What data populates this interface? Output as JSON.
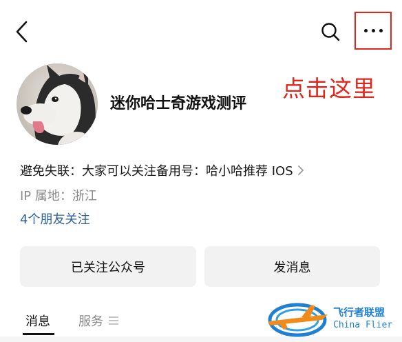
{
  "header": {
    "back_icon": "chevron-left-icon",
    "search_icon": "search-icon",
    "more_icon": "more-horizontal-icon",
    "highlight_color": "#e0261c"
  },
  "annotation": {
    "text": "点击这里",
    "color": "#e0261c"
  },
  "profile": {
    "avatar": "husky-dog-avatar",
    "name": "迷你哈士奇游戏测评",
    "description": "避免失联：大家可以关注备用号：哈小哈推荐 IOS",
    "ip_location": "IP 属地：浙江",
    "friends_following": "4个朋友关注",
    "link_color": "#2d5f9a"
  },
  "actions": {
    "followed_label": "已关注公众号",
    "message_label": "发消息"
  },
  "tabs": [
    {
      "label": "消息",
      "active": true
    },
    {
      "label": "服务",
      "active": false,
      "icon": "menu-icon"
    }
  ],
  "watermark": {
    "title": "飞行者联盟",
    "subtitle": "China Flier",
    "color": "#1f7fd1"
  }
}
